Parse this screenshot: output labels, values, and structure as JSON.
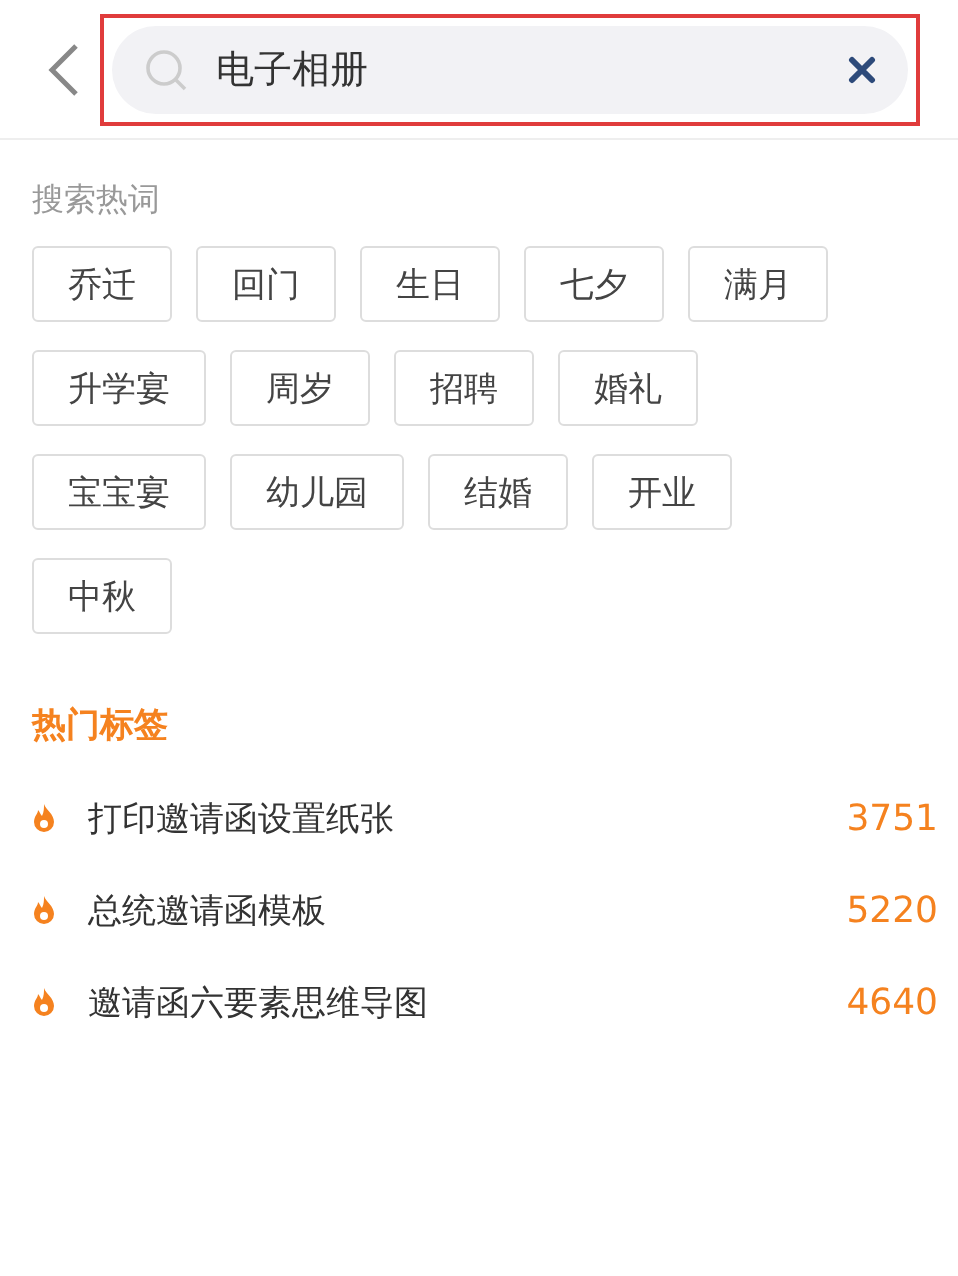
{
  "search": {
    "value": "电子相册",
    "highlighted": true
  },
  "hot_words": {
    "title": "搜索热词",
    "items": [
      "乔迁",
      "回门",
      "生日",
      "七夕",
      "满月",
      "升学宴",
      "周岁",
      "招聘",
      "婚礼",
      "宝宝宴",
      "幼儿园",
      "结婚",
      "开业",
      "中秋"
    ]
  },
  "hot_tags": {
    "title": "热门标签",
    "items": [
      {
        "label": "打印邀请函设置纸张",
        "count": "3751"
      },
      {
        "label": "总统邀请函模板",
        "count": "5220"
      },
      {
        "label": "邀请函六要素思维导图",
        "count": "4640"
      }
    ]
  }
}
